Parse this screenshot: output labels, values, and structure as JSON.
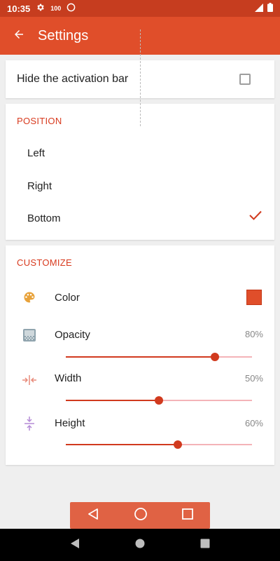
{
  "status_bar": {
    "time": "10:35",
    "indicator": "100"
  },
  "app_bar": {
    "title": "Settings"
  },
  "hide_bar": {
    "label": "Hide the activation bar",
    "checked": false
  },
  "position": {
    "title": "POSITION",
    "options": [
      "Left",
      "Right",
      "Bottom"
    ],
    "selected": "Bottom"
  },
  "customize": {
    "title": "CUSTOMIZE",
    "color": {
      "label": "Color",
      "value": "#e04e2a"
    },
    "opacity": {
      "label": "Opacity",
      "value_text": "80%",
      "value": 80
    },
    "width": {
      "label": "Width",
      "value_text": "50%",
      "value": 50
    },
    "height": {
      "label": "Height",
      "value_text": "60%",
      "value": 60
    }
  },
  "colors": {
    "accent": "#e04e2a",
    "status_bar": "#c63d1f",
    "overlay": "#e06244"
  }
}
